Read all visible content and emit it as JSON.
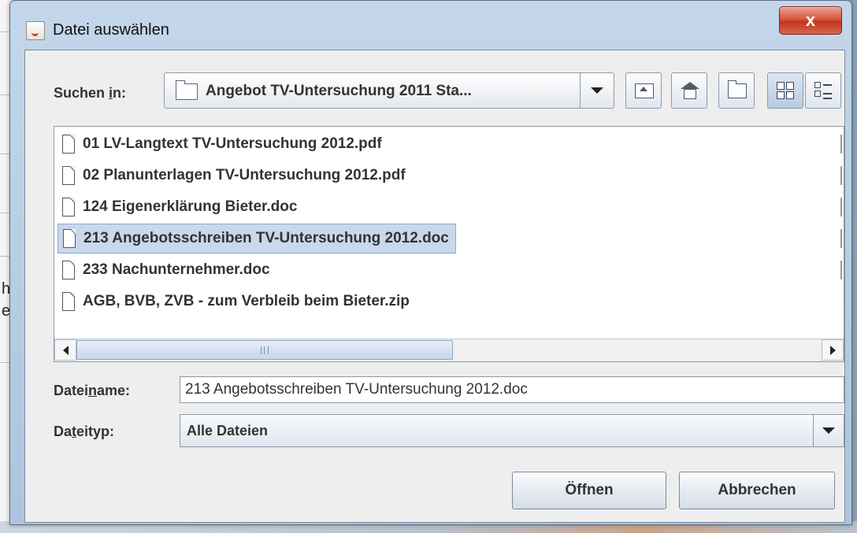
{
  "background": {
    "left_fragments": [
      "h",
      "e"
    ]
  },
  "window": {
    "title": "Datei auswählen",
    "close_label": "x"
  },
  "lookin": {
    "label_before": "Suchen ",
    "label_mnemonic": "i",
    "label_after": "n:",
    "value": "Angebot TV-Untersuchung 2011 Sta...",
    "icon": "folder-icon"
  },
  "toolbar": {
    "buttons": [
      {
        "name": "up-one-level",
        "icon": "folder-up-icon"
      },
      {
        "name": "home",
        "icon": "home-icon"
      },
      {
        "name": "new-folder",
        "icon": "new-folder-icon"
      },
      {
        "name": "list-view",
        "icon": "list-view-icon",
        "active": true
      },
      {
        "name": "details-view",
        "icon": "details-view-icon",
        "active": false
      }
    ]
  },
  "files": [
    {
      "name": "01 LV-Langtext TV-Untersuchung 2012.pdf",
      "selected": false
    },
    {
      "name": "02 Planunterlagen TV-Untersuchung 2012.pdf",
      "selected": false
    },
    {
      "name": "124 Eigenerklärung Bieter.doc",
      "selected": false
    },
    {
      "name": "213 Angebotsschreiben TV-Untersuchung 2012.doc",
      "selected": true
    },
    {
      "name": "233 Nachunternehmer.doc",
      "selected": false
    },
    {
      "name": "AGB, BVB, ZVB - zum Verbleib beim Bieter.zip",
      "selected": false
    }
  ],
  "filename": {
    "label_before": "Datei",
    "label_mnemonic": "n",
    "label_after": "ame:",
    "value": "213 Angebotsschreiben TV-Untersuchung 2012.doc"
  },
  "filetype": {
    "label_before": "Da",
    "label_mnemonic": "t",
    "label_after": "eityp:",
    "value": "Alle Dateien"
  },
  "actions": {
    "open_label": "Öffnen",
    "cancel_label": "Abbrechen"
  }
}
